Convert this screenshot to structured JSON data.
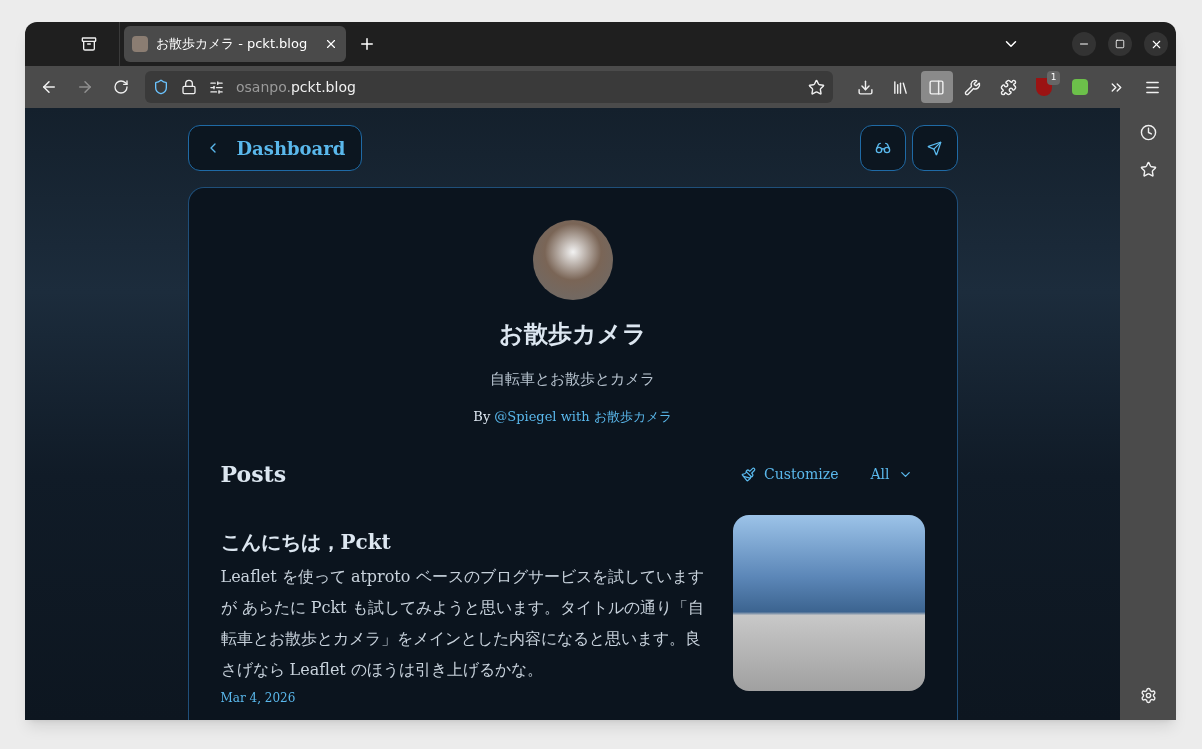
{
  "browser": {
    "tabs": [
      {
        "title": "お散歩カメラ - pckt.blog",
        "selected": true
      }
    ],
    "url": {
      "prefix": "osanpo.",
      "host": "pckt.blog"
    },
    "extension_badge": "1",
    "sidebar_toggle": {
      "selected": true
    }
  },
  "page": {
    "back_button": "Dashboard",
    "blog": {
      "title": "お散歩カメラ",
      "description": "自転車とお散歩とカメラ",
      "by_label": "By",
      "author_link": "@Spiegel with お散歩カメラ"
    },
    "posts_heading": "Posts",
    "customize": "Customize",
    "filter": "All",
    "posts": [
      {
        "title": "こんにちは，Pckt",
        "excerpt": "Leaflet を使って atproto ベースのブログサービスを試していますが あらたに Pckt も試してみようと思います。タイトルの通り「自転車とお散歩とカメラ」をメインとした内容になると思います。良さげなら Leaflet のほうは引き上げるかな。",
        "date": "Mar 4, 2026"
      }
    ]
  }
}
